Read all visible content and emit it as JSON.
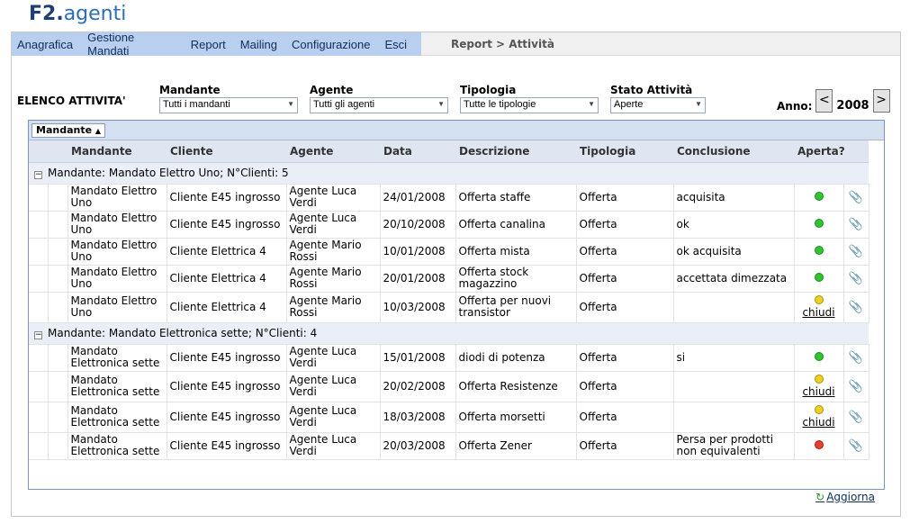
{
  "app": {
    "logo_prefix": "F2.",
    "logo_suffix": "agenti"
  },
  "menu": [
    "Anagrafica",
    "Gestione Mandati",
    "Report",
    "Mailing",
    "Configurazione",
    "Esci"
  ],
  "breadcrumb": "Report > Attività",
  "page_title": "ELENCO ATTIVITA'",
  "filters": {
    "mandante": {
      "label": "Mandante",
      "value": "Tutti i mandanti"
    },
    "agente": {
      "label": "Agente",
      "value": "Tutti gli agenti"
    },
    "tipologia": {
      "label": "Tipologia",
      "value": "Tutte le tipologie"
    },
    "stato": {
      "label": "Stato Attività",
      "value": "Aperte"
    }
  },
  "year": {
    "label": "Anno:",
    "value": "2008",
    "prev": "<",
    "next": ">"
  },
  "grid": {
    "group_chip": "Mandante",
    "columns": [
      "Mandante",
      "Cliente",
      "Agente",
      "Data",
      "Descrizione",
      "Tipologia",
      "Conclusione",
      "Aperta?"
    ],
    "groups": [
      {
        "label": "Mandante: Mandato Elettro Uno; N°Clienti: 5",
        "rows": [
          {
            "mandante": "Mandato Elettro Uno",
            "cliente": "Cliente E45 ingrosso",
            "agente": "Agente Luca Verdi",
            "data": "24/01/2008",
            "descrizione": "Offerta staffe",
            "tipologia": "Offerta",
            "conclusione": "acquisita",
            "status": "green",
            "action": ""
          },
          {
            "mandante": "Mandato Elettro Uno",
            "cliente": "Cliente E45 ingrosso",
            "agente": "Agente Luca Verdi",
            "data": "20/10/2008",
            "descrizione": "Offerta canalina",
            "tipologia": "Offerta",
            "conclusione": "ok",
            "status": "green",
            "action": ""
          },
          {
            "mandante": "Mandato Elettro Uno",
            "cliente": "Cliente Elettrica 4",
            "agente": "Agente Mario Rossi",
            "data": "10/01/2008",
            "descrizione": "Offerta mista",
            "tipologia": "Offerta",
            "conclusione": "ok acquisita",
            "status": "green",
            "action": ""
          },
          {
            "mandante": "Mandato Elettro Uno",
            "cliente": "Cliente Elettrica 4",
            "agente": "Agente Mario Rossi",
            "data": "20/01/2008",
            "descrizione": "Offerta stock magazzino",
            "tipologia": "Offerta",
            "conclusione": "accettata dimezzata",
            "status": "green",
            "action": ""
          },
          {
            "mandante": "Mandato Elettro Uno",
            "cliente": "Cliente Elettrica 4",
            "agente": "Agente Mario Rossi",
            "data": "10/03/2008",
            "descrizione": "Offerta per nuovi transistor",
            "tipologia": "Offerta",
            "conclusione": "",
            "status": "yellow",
            "action": "chiudi"
          }
        ]
      },
      {
        "label": "Mandante: Mandato Elettronica sette; N°Clienti: 4",
        "rows": [
          {
            "mandante": "Mandato Elettronica sette",
            "cliente": "Cliente E45 ingrosso",
            "agente": "Agente Luca Verdi",
            "data": "15/01/2008",
            "descrizione": "diodi di potenza",
            "tipologia": "Offerta",
            "conclusione": "si",
            "status": "green",
            "action": ""
          },
          {
            "mandante": "Mandato Elettronica sette",
            "cliente": "Cliente E45 ingrosso",
            "agente": "Agente Luca Verdi",
            "data": "20/02/2008",
            "descrizione": "Offerta Resistenze",
            "tipologia": "Offerta",
            "conclusione": "",
            "status": "yellow",
            "action": "chiudi"
          },
          {
            "mandante": "Mandato Elettronica sette",
            "cliente": "Cliente E45 ingrosso",
            "agente": "Agente Luca Verdi",
            "data": "18/03/2008",
            "descrizione": "Offerta morsetti",
            "tipologia": "Offerta",
            "conclusione": "",
            "status": "yellow",
            "action": "chiudi"
          },
          {
            "mandante": "Mandato Elettronica sette",
            "cliente": "Cliente E45 ingrosso",
            "agente": "Agente Luca Verdi",
            "data": "20/03/2008",
            "descrizione": "Offerta Zener",
            "tipologia": "Offerta",
            "conclusione": "Persa per prodotti non equivalenti",
            "status": "red",
            "action": ""
          }
        ]
      }
    ],
    "refresh_label": "Aggiorna"
  }
}
